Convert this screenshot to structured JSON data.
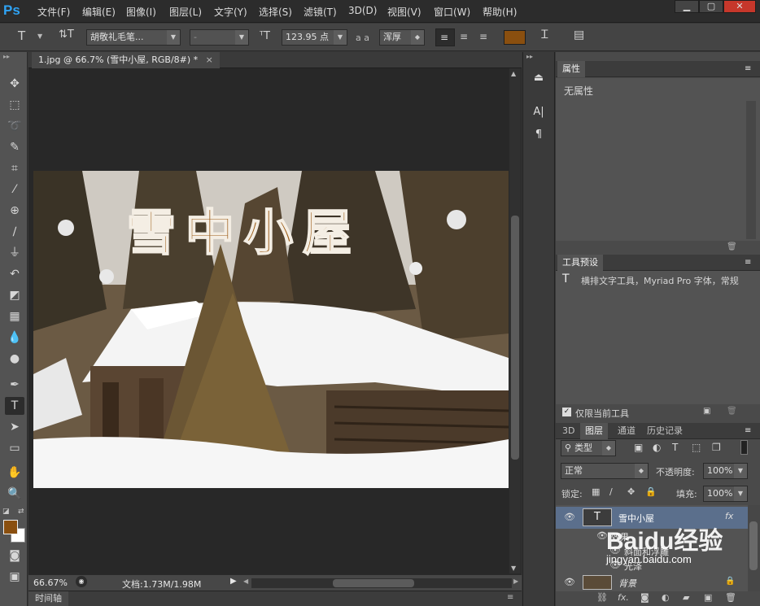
{
  "app": {
    "logo": "Ps"
  },
  "menubar": {
    "items": [
      "文件(F)",
      "编辑(E)",
      "图像(I)",
      "图层(L)",
      "文字(Y)",
      "选择(S)",
      "滤镜(T)",
      "3D(D)",
      "视图(V)",
      "窗口(W)",
      "帮助(H)"
    ],
    "win_minimize": "▁",
    "win_restore": "▢",
    "win_close": "✕"
  },
  "options": {
    "font_family": "胡敬礼毛笔...",
    "font_style": "-",
    "font_size": "123.95 点",
    "aa_label": "a a",
    "antialias": "浑厚",
    "text_color": "#8a4f0f"
  },
  "document": {
    "tab_title": "1.jpg @ 66.7% (雪中小屋, RGB/8#) *",
    "tab_close": "×",
    "canvas_text": "雪中小屋"
  },
  "status": {
    "zoom": "66.67%",
    "doc_info": "文档:1.73M/1.98M"
  },
  "timeline": {
    "label": "时间轴"
  },
  "colors": {
    "foreground": "#8a4f0f",
    "background": "#ffffff"
  },
  "properties_panel": {
    "title": "属性",
    "content": "无属性"
  },
  "tool_presets_panel": {
    "title": "工具预设",
    "item": "横排文字工具，Myriad Pro 字体，常规",
    "checkbox_label": "仅限当前工具"
  },
  "layers_panel": {
    "tabs": [
      "3D",
      "图层",
      "通道",
      "历史记录"
    ],
    "filter_label": "类型",
    "blend_mode": "正常",
    "opacity_label": "不透明度:",
    "opacity_value": "100%",
    "lock_label": "锁定:",
    "fill_label": "填充:",
    "fill_value": "100%",
    "layers": [
      {
        "name": "雪中小屋",
        "type": "text",
        "fx": "fx"
      },
      {
        "name": "效果",
        "type": "effects-group"
      },
      {
        "name": "斜面和浮雕",
        "type": "effect"
      },
      {
        "name": "光泽",
        "type": "effect"
      },
      {
        "name": "背景",
        "type": "image"
      }
    ]
  },
  "watermark": {
    "text": "Baidu经验",
    "url": "jingyan.baidu.com"
  }
}
